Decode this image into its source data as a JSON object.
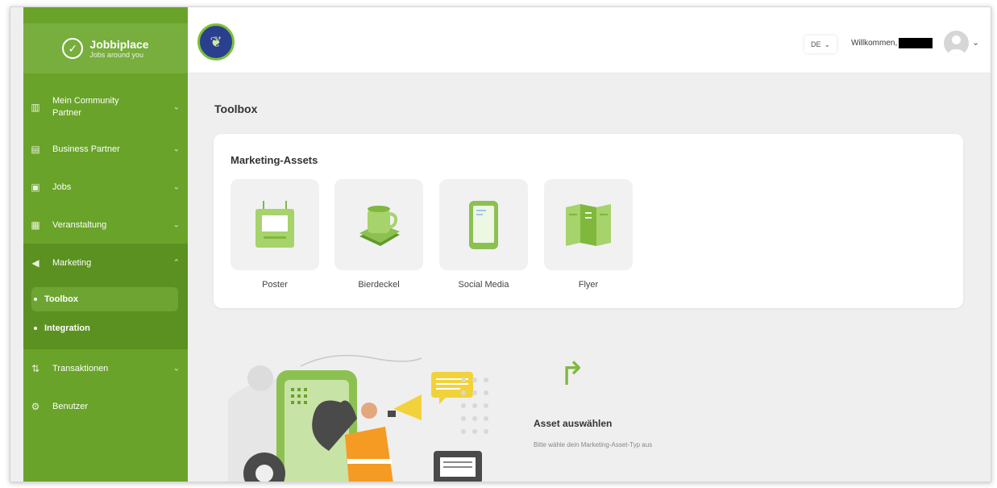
{
  "brand": {
    "name": "Jobbiplace",
    "tagline": "Jobs around you"
  },
  "sidebar": {
    "items": [
      {
        "label": "Mein Community Partner"
      },
      {
        "label": "Business Partner"
      },
      {
        "label": "Jobs"
      },
      {
        "label": "Veranstaltung"
      },
      {
        "label": "Marketing"
      },
      {
        "label": "Transaktionen"
      },
      {
        "label": "Benutzer"
      }
    ],
    "marketing_sub": [
      {
        "label": "Toolbox"
      },
      {
        "label": "Integration"
      }
    ]
  },
  "header": {
    "language": "DE",
    "welcome": "Willkommen,"
  },
  "main": {
    "title": "Toolbox",
    "card_title": "Marketing-Assets",
    "assets": [
      {
        "label": "Poster",
        "icon": "poster-icon"
      },
      {
        "label": "Bierdeckel",
        "icon": "coaster-cup-icon"
      },
      {
        "label": "Social Media",
        "icon": "phone-icon"
      },
      {
        "label": "Flyer",
        "icon": "flyer-icon"
      }
    ],
    "cta_title": "Asset auswählen",
    "cta_subtitle": "Bitte wähle dein Marketing-Asset-Typ aus"
  },
  "colors": {
    "brand_green": "#69a329",
    "light_green": "#8cc152",
    "accent_orange": "#f59a23"
  }
}
